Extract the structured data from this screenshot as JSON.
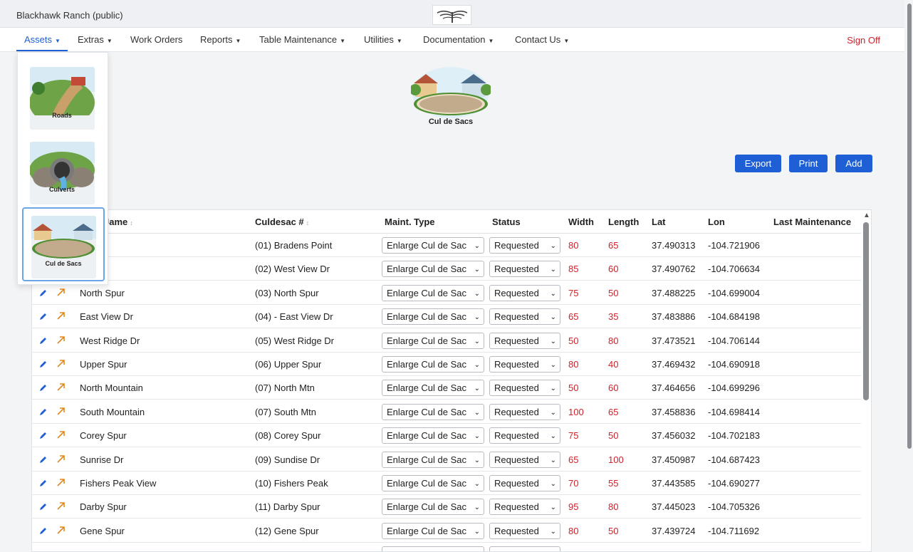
{
  "app": {
    "title": "Blackhawk Ranch (public)",
    "logo": "hawk-logo"
  },
  "nav": {
    "items": [
      {
        "label": "Assets"
      },
      {
        "label": "Extras"
      },
      {
        "label": "Work Orders"
      },
      {
        "label": "Reports"
      },
      {
        "label": "Table Maintenance"
      },
      {
        "label": "Utilities"
      },
      {
        "label": "Documentation"
      },
      {
        "label": "Contact Us"
      }
    ],
    "caret": "⌄",
    "signoff": "Sign Off"
  },
  "assets_menu": {
    "items": [
      {
        "label": "Roads"
      },
      {
        "label": "Culverts"
      },
      {
        "label": "Cul de Sacs"
      }
    ]
  },
  "page": {
    "header_label": "Cul de Sacs"
  },
  "actions": {
    "export": "Export",
    "print": "Print",
    "add": "Add"
  },
  "table": {
    "headers": {
      "name": "Name",
      "name_visible": "Jame",
      "culdesac": "Culdesac #",
      "maint_type": "Maint. Type",
      "status": "Status",
      "width": "Width",
      "length": "Length",
      "lat": "Lat",
      "lon": "Lon",
      "last_maintenance": "Last Maintenance"
    },
    "rows": [
      {
        "name": "s Point",
        "culdesac": "(01) Bradens Point",
        "maint": "Enlarge Cul de Sac",
        "status": "Requested",
        "width": "80",
        "length": "65",
        "lat": "37.490313",
        "lon": "-104.721906"
      },
      {
        "name": "iew Dr",
        "culdesac": "(02) West View Dr",
        "maint": "Enlarge Cul de Sac",
        "status": "Requested",
        "width": "85",
        "length": "60",
        "lat": "37.490762",
        "lon": "-104.706634"
      },
      {
        "name": "North Spur",
        "culdesac": "(03) North Spur",
        "maint": "Enlarge Cul de Sac",
        "status": "Requested",
        "width": "75",
        "length": "50",
        "lat": "37.488225",
        "lon": "-104.699004"
      },
      {
        "name": "East View Dr",
        "culdesac": "(04) - East View Dr",
        "maint": "Enlarge Cul de Sac",
        "status": "Requested",
        "width": "65",
        "length": "35",
        "lat": "37.483886",
        "lon": "-104.684198"
      },
      {
        "name": "West Ridge Dr",
        "culdesac": "(05) West Ridge Dr",
        "maint": "Enlarge Cul de Sac",
        "status": "Requested",
        "width": "50",
        "length": "80",
        "lat": "37.473521",
        "lon": "-104.706144"
      },
      {
        "name": "Upper Spur",
        "culdesac": "(06) Upper Spur",
        "maint": "Enlarge Cul de Sac",
        "status": "Requested",
        "width": "80",
        "length": "40",
        "lat": "37.469432",
        "lon": "-104.690918"
      },
      {
        "name": "North Mountain",
        "culdesac": "(07) North Mtn",
        "maint": "Enlarge Cul de Sac",
        "status": "Requested",
        "width": "50",
        "length": "60",
        "lat": "37.464656",
        "lon": "-104.699296"
      },
      {
        "name": "South Mountain",
        "culdesac": "(07) South Mtn",
        "maint": "Enlarge Cul de Sac",
        "status": "Requested",
        "width": "100",
        "length": "65",
        "lat": "37.458836",
        "lon": "-104.698414"
      },
      {
        "name": "Corey Spur",
        "culdesac": "(08) Corey Spur",
        "maint": "Enlarge Cul de Sac",
        "status": "Requested",
        "width": "75",
        "length": "50",
        "lat": "37.456032",
        "lon": "-104.702183"
      },
      {
        "name": "Sunrise Dr",
        "culdesac": "(09) Sundise Dr",
        "maint": "Enlarge Cul de Sac",
        "status": "Requested",
        "width": "65",
        "length": "100",
        "lat": "37.450987",
        "lon": "-104.687423"
      },
      {
        "name": "Fishers Peak View",
        "culdesac": "(10) Fishers Peak",
        "maint": "Enlarge Cul de Sac",
        "status": "Requested",
        "width": "70",
        "length": "55",
        "lat": "37.443585",
        "lon": "-104.690277"
      },
      {
        "name": "Darby Spur",
        "culdesac": "(11) Darby Spur",
        "maint": "Enlarge Cul de Sac",
        "status": "Requested",
        "width": "95",
        "length": "80",
        "lat": "37.445023",
        "lon": "-104.705326"
      },
      {
        "name": "Gene Spur",
        "culdesac": "(12) Gene Spur",
        "maint": "Enlarge Cul de Sac",
        "status": "Requested",
        "width": "80",
        "length": "50",
        "lat": "37.439724",
        "lon": "-104.711692"
      }
    ]
  },
  "colors": {
    "accent": "#1f5fd6",
    "danger": "#d0202a",
    "edit_icon": "#1f5fd6",
    "link_icon": "#e08a1e"
  },
  "icons": {
    "edit": "pencil-icon",
    "open": "arrow-up-right-icon",
    "sort": "sort-icon",
    "select_arrow": "chevron-down-icon"
  }
}
